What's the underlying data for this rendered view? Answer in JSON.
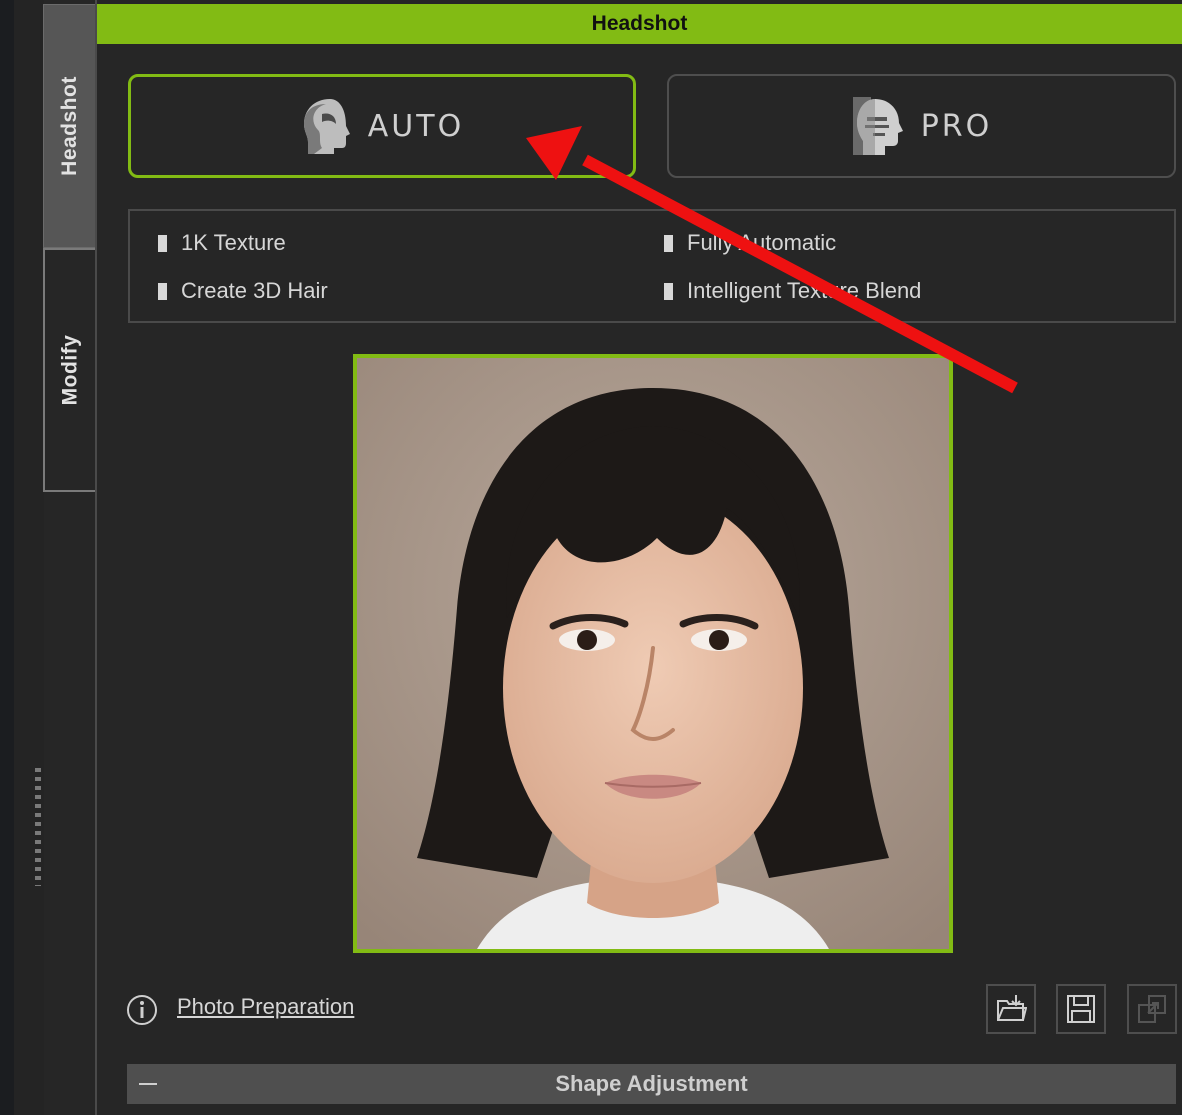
{
  "sidebar": {
    "tabs": [
      {
        "label": "Headshot",
        "active": true
      },
      {
        "label": "Modify",
        "active": false
      }
    ]
  },
  "header": {
    "title": "Headshot"
  },
  "modes": {
    "auto": {
      "label": "AUTO",
      "icon": "auto-head-icon",
      "selected": true
    },
    "pro": {
      "label": "PRO",
      "icon": "pro-head-icon",
      "selected": false
    }
  },
  "features": {
    "items": [
      "1K Texture",
      "Fully Automatic",
      "Create 3D Hair",
      "Intelligent Texture Blend"
    ]
  },
  "photo": {
    "description": "headshot-photo"
  },
  "footer": {
    "photo_prep_label": "Photo Preparation",
    "icons": [
      "info-icon",
      "load-photo-icon",
      "save-icon",
      "export-icon"
    ]
  },
  "section": {
    "title": "Shape Adjustment"
  },
  "colors": {
    "accent": "#82bb14",
    "background": "#262626",
    "annotation_arrow": "#ee1111"
  }
}
